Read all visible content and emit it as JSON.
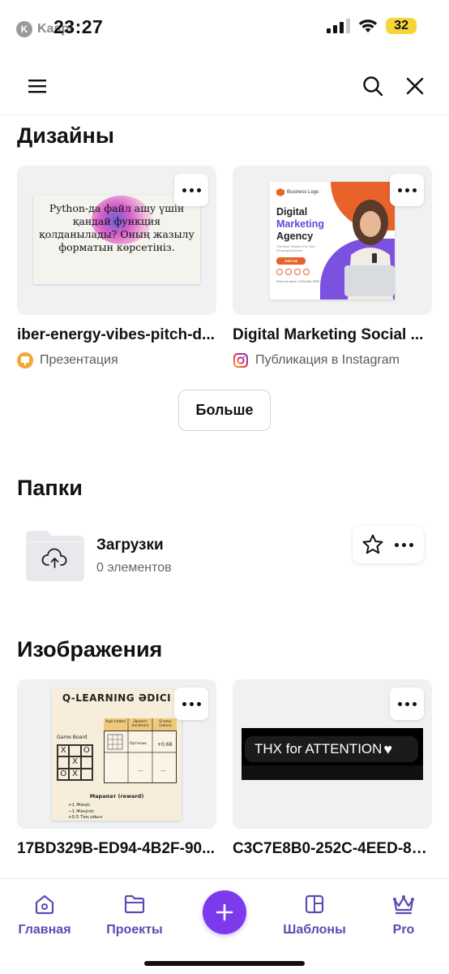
{
  "status": {
    "back_label": "Kaspi",
    "time": "23:27",
    "battery": "32"
  },
  "designs": {
    "title": "Дизайны",
    "items": [
      {
        "title": "iber-energy-vibes-pitch-d...",
        "type": "Презентация",
        "icon": "presentation-icon",
        "slide_text": "Python-да файл ашу үшін қандай функция қолданылады? Оның жазылу форматын көрсетініз."
      },
      {
        "title": "Digital Marketing Social ...",
        "type": "Публикация в Instagram",
        "icon": "instagram-icon",
        "poster": {
          "logo": "Business Logo",
          "line1": "Digital",
          "line2": "Marketing",
          "line3": "Agency",
          "tagline": "The Best Solution For Your Growing Business",
          "cta": "Join Us",
          "contact": "Find out more +123-456-7890"
        }
      }
    ],
    "more_label": "Больше"
  },
  "folders": {
    "title": "Папки",
    "items": [
      {
        "name": "Загрузки",
        "count": "0 элементов"
      }
    ]
  },
  "images": {
    "title": "Изображения",
    "items": [
      {
        "title": "17BD329B-ED94-4B2F-90...",
        "board": {
          "heading": "Q-LEARNING ӘDICI",
          "game_board": "Game Board",
          "col1": "Күй (state)",
          "col2": "Әрекет (location)",
          "col3": "Q мәні (value)",
          "row1_mid": "Орталық",
          "row1_val": "+0,68",
          "reward": "Марапат (reward)",
          "legend1": "+1  Жеңіс",
          "legend2": "−1  Жеңіліс",
          "legend3": "+0,5  Тең ойын"
        }
      },
      {
        "title": "C3C7E8B0-252C-4EED-8F...",
        "thx_text": "THX for ATTENTION"
      }
    ]
  },
  "nav": {
    "items": [
      {
        "label": "Главная",
        "icon": "home-icon"
      },
      {
        "label": "Проекты",
        "icon": "folder-icon"
      },
      {
        "label": "Шаблоны",
        "icon": "templates-icon"
      },
      {
        "label": "Pro",
        "icon": "crown-icon"
      }
    ],
    "create": "plus-icon"
  },
  "colors": {
    "accent": "#7c3aed",
    "nav_text": "#5a4cb5",
    "battery": "#f7d53a"
  }
}
